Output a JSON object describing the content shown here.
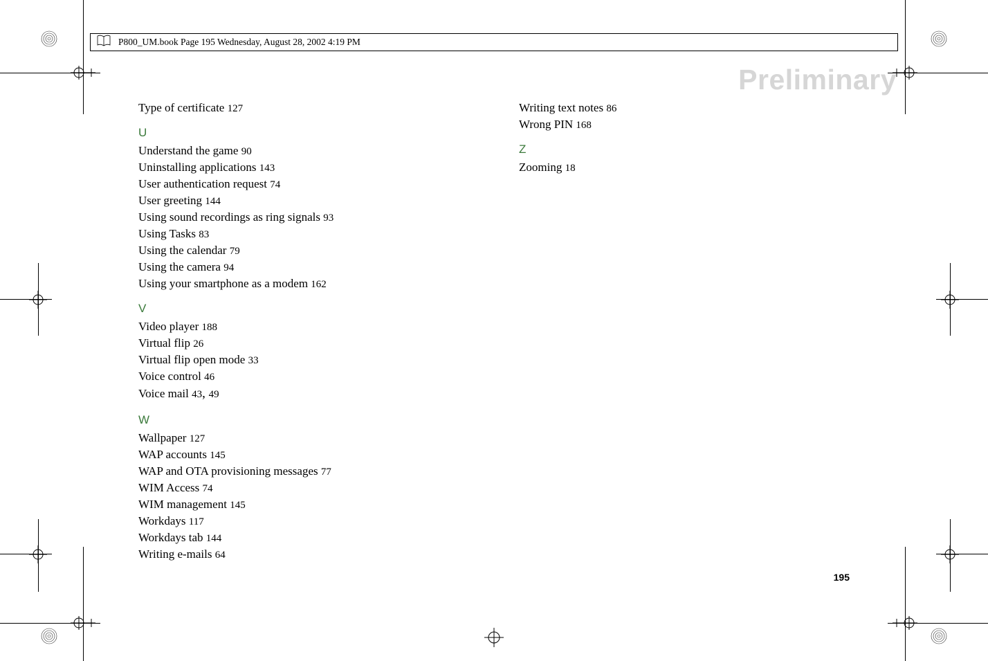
{
  "header": {
    "filename_line": "P800_UM.book  Page 195  Wednesday, August 28, 2002  4:19 PM"
  },
  "watermark": "Preliminary",
  "page_number": "195",
  "left_column": {
    "top_entry": {
      "text": "Type of certificate",
      "page": "127"
    },
    "sections": [
      {
        "letter": "U",
        "entries": [
          {
            "text": "Understand the game",
            "page": "90"
          },
          {
            "text": "Uninstalling applications",
            "page": "143"
          },
          {
            "text": "User authentication request",
            "page": "74"
          },
          {
            "text": "User greeting",
            "page": "144"
          },
          {
            "text": "Using sound recordings as ring signals",
            "page": "93"
          },
          {
            "text": "Using Tasks",
            "page": "83"
          },
          {
            "text": "Using the calendar",
            "page": "79"
          },
          {
            "text": "Using the camera",
            "page": "94"
          },
          {
            "text": "Using your smartphone as a modem",
            "page": "162"
          }
        ]
      },
      {
        "letter": "V",
        "entries": [
          {
            "text": "Video player",
            "page": "188"
          },
          {
            "text": "Virtual flip",
            "page": "26"
          },
          {
            "text": "Virtual flip open mode",
            "page": "33"
          },
          {
            "text": "Voice control",
            "page": "46"
          },
          {
            "text": "Voice mail",
            "page": "43",
            "page2": "49"
          }
        ]
      },
      {
        "letter": "W",
        "entries": [
          {
            "text": "Wallpaper",
            "page": "127"
          },
          {
            "text": "WAP accounts",
            "page": "145"
          },
          {
            "text": "WAP and OTA provisioning messages",
            "page": "77"
          },
          {
            "text": "WIM Access",
            "page": "74"
          },
          {
            "text": "WIM management",
            "page": "145"
          },
          {
            "text": "Workdays",
            "page": "117"
          },
          {
            "text": "Workdays tab",
            "page": "144"
          },
          {
            "text": "Writing e-mails",
            "page": "64"
          }
        ]
      }
    ]
  },
  "right_column": {
    "top_entries": [
      {
        "text": "Writing text notes",
        "page": "86"
      },
      {
        "text": "Wrong PIN",
        "page": "168"
      }
    ],
    "sections": [
      {
        "letter": "Z",
        "entries": [
          {
            "text": "Zooming",
            "page": "18"
          }
        ]
      }
    ]
  }
}
